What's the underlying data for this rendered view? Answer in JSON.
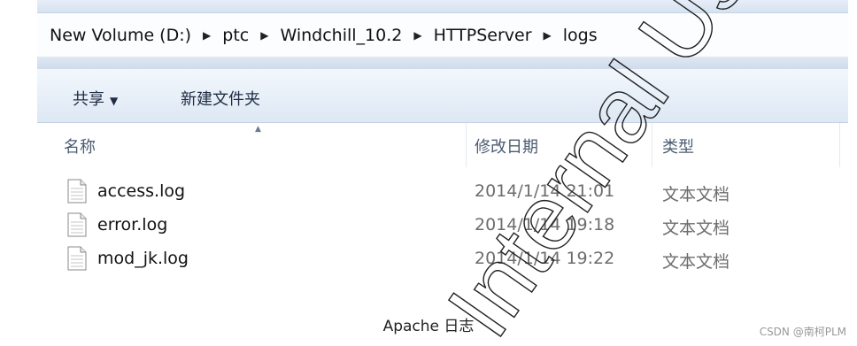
{
  "breadcrumb": [
    "New Volume (D:)",
    "ptc",
    "Windchill_10.2",
    "HTTPServer",
    "logs"
  ],
  "toolbar": {
    "share_label": "共享",
    "new_folder_label": "新建文件夹"
  },
  "columns": {
    "name": "名称",
    "modified": "修改日期",
    "type": "类型"
  },
  "files": [
    {
      "name": "access.log",
      "modified": "2014/1/14 21:01",
      "type": "文本文档",
      "icon": "text-file-icon"
    },
    {
      "name": "error.log",
      "modified": "2014/1/14 19:18",
      "type": "文本文档",
      "icon": "text-file-icon"
    },
    {
      "name": "mod_jk.log",
      "modified": "2014/1/14 19:22",
      "type": "文本文档",
      "icon": "text-file-icon"
    }
  ],
  "caption": "Apache 日志",
  "credit": "CSDN @南柯PLM",
  "watermark": "Internal Use Only"
}
